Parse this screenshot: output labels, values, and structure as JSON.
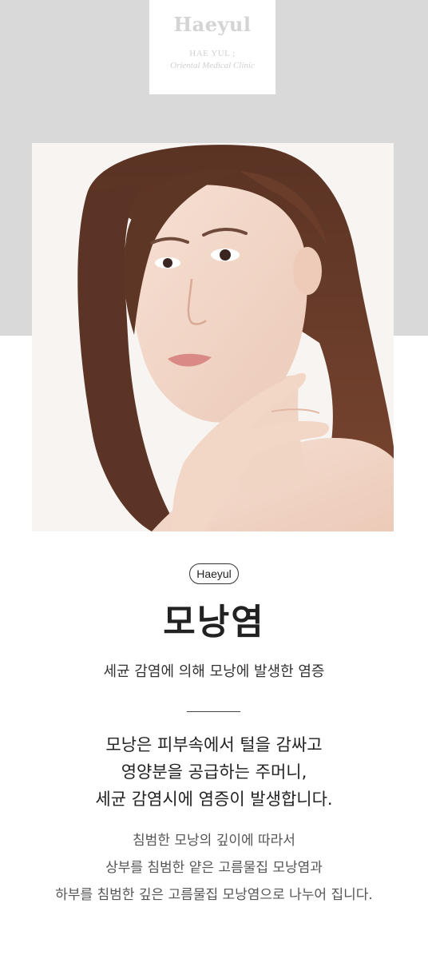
{
  "header": {
    "logo_title": "Haeyul",
    "logo_sub1": "HAE YUL ;",
    "logo_sub2": "Oriental Medical Clinic"
  },
  "hero_image": {
    "description_icon": "portrait-photo"
  },
  "content": {
    "badge": "Haeyul",
    "title": "모낭염",
    "subtitle": "세균 감염에 의해 모낭에 발생한 염증",
    "lead_lines": [
      "모낭은 피부속에서 털을 감싸고",
      "영양분을 공급하는 주머니,",
      "세균 감염시에 염증이 발생합니다."
    ],
    "body_lines": [
      "침범한 모낭의 깊이에 따라서",
      "상부를 침범한 얕은 고름물집 모낭염과",
      "하부를 침범한 깊은 고름물집 모낭염으로 나누어 집니다."
    ]
  },
  "colors": {
    "band": "#d9d9d9",
    "logo_text": "#d4d4d4",
    "text": "#222222"
  }
}
